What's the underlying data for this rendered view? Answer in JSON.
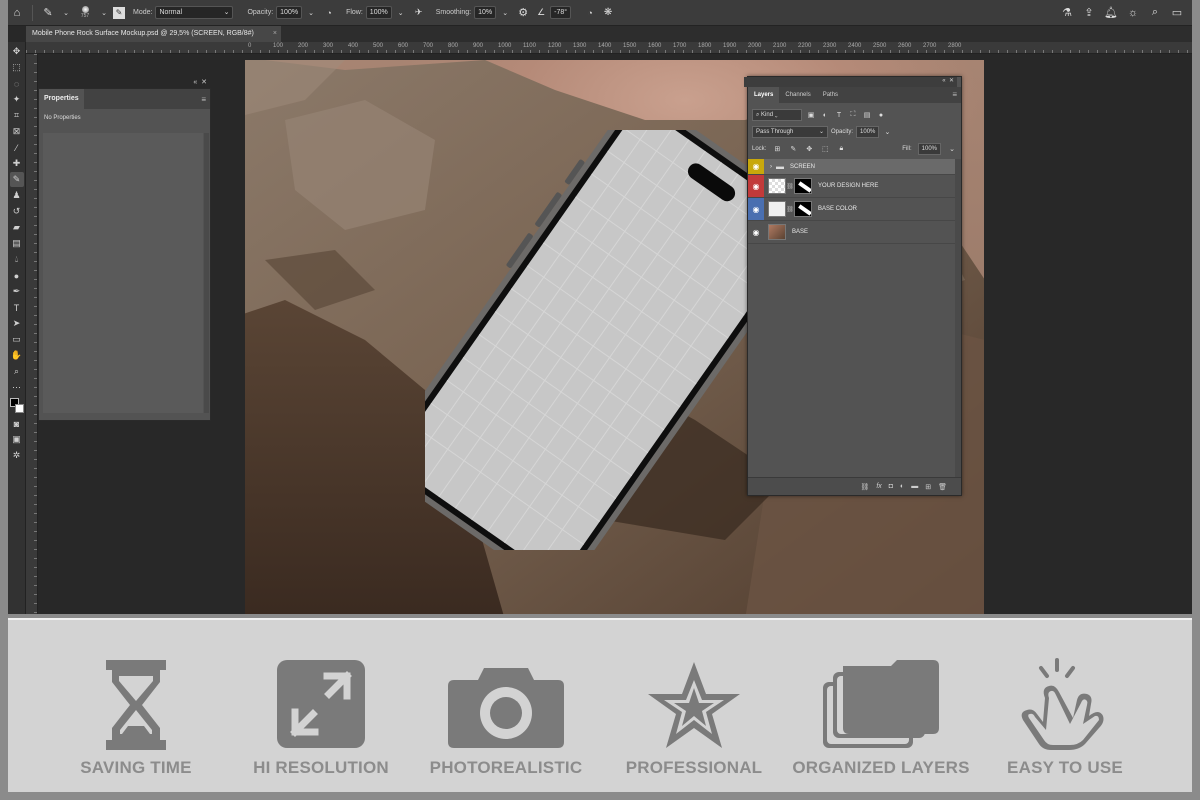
{
  "options_bar": {
    "brush_size": "757",
    "mode_label": "Mode:",
    "mode_value": "Normal",
    "opacity_label": "Opacity:",
    "opacity_value": "100%",
    "flow_label": "Flow:",
    "flow_value": "100%",
    "smoothing_label": "Smoothing:",
    "smoothing_value": "10%",
    "angle_value": "-78°"
  },
  "document_tab": {
    "title": "Mobile Phone Rock Surface Mockup.psd @ 29,5% (SCREEN, RGB/8#)",
    "close": "×"
  },
  "ruler_ticks": [
    "0",
    "100",
    "200",
    "300",
    "400",
    "500",
    "600",
    "700",
    "800",
    "900",
    "1000",
    "1100",
    "1200",
    "1300",
    "1400",
    "1500",
    "1600",
    "1700",
    "1800",
    "1900",
    "2000",
    "2100",
    "2200",
    "2300",
    "2400",
    "2500",
    "2600",
    "2700",
    "2800"
  ],
  "properties_panel": {
    "title": "Properties",
    "body_text": "No Properties"
  },
  "layers_panel": {
    "tabs": [
      "Layers",
      "Channels",
      "Paths"
    ],
    "active_tab": "Layers",
    "filter_label": "Kind",
    "blend_mode": "Pass Through",
    "opacity_label": "Opacity:",
    "opacity_value": "100%",
    "lock_label": "Lock:",
    "fill_label": "Fill:",
    "fill_value": "100%",
    "layers": [
      {
        "name": "SCREEN",
        "eye_color": "#c8a80c",
        "type": "group",
        "selected": true
      },
      {
        "name": "YOUR DESIGN HERE",
        "eye_color": "#c23a3a",
        "type": "smart",
        "selected": false
      },
      {
        "name": "BASE COLOR",
        "eye_color": "#4a6fb0",
        "type": "fill",
        "selected": false
      },
      {
        "name": "BASE",
        "eye_color": "#535353",
        "type": "image",
        "selected": false
      }
    ],
    "footer_icons": [
      "link-icon",
      "fx-icon",
      "mask-icon",
      "adjustment-icon",
      "folder-icon",
      "new-layer-icon",
      "trash-icon"
    ]
  },
  "features": [
    {
      "label": "SAVING TIME",
      "icon": "hourglass-icon"
    },
    {
      "label": "HI RESOLUTION",
      "icon": "expand-icon"
    },
    {
      "label": "PHOTOREALISTIC",
      "icon": "camera-icon"
    },
    {
      "label": "PROFESSIONAL",
      "icon": "star-icon"
    },
    {
      "label": "ORGANIZED LAYERS",
      "icon": "layers-icon"
    },
    {
      "label": "EASY TO USE",
      "icon": "tap-hand-icon"
    }
  ],
  "colors": {
    "icon_gray": "#7a7a7a",
    "label_gray": "#8c8c8c",
    "strip_bg": "#d3d3d3"
  }
}
